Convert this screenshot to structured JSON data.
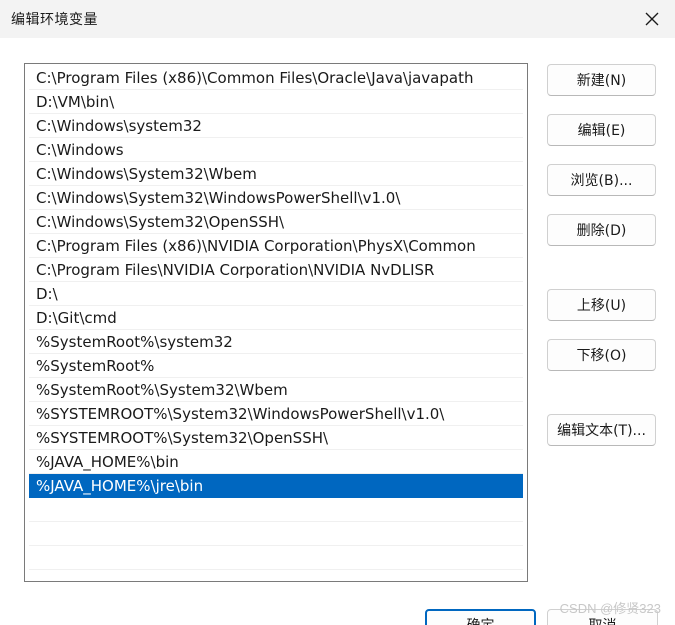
{
  "window": {
    "title": "编辑环境变量"
  },
  "path_list": {
    "entries": [
      "C:\\Program Files (x86)\\Common Files\\Oracle\\Java\\javapath",
      "D:\\VM\\bin\\",
      "C:\\Windows\\system32",
      "C:\\Windows",
      "C:\\Windows\\System32\\Wbem",
      "C:\\Windows\\System32\\WindowsPowerShell\\v1.0\\",
      "C:\\Windows\\System32\\OpenSSH\\",
      "C:\\Program Files (x86)\\NVIDIA Corporation\\PhysX\\Common",
      "C:\\Program Files\\NVIDIA Corporation\\NVIDIA NvDLISR",
      "D:\\",
      "D:\\Git\\cmd",
      "%SystemRoot%\\system32",
      "%SystemRoot%",
      "%SystemRoot%\\System32\\Wbem",
      "%SYSTEMROOT%\\System32\\WindowsPowerShell\\v1.0\\",
      "%SYSTEMROOT%\\System32\\OpenSSH\\",
      "%JAVA_HOME%\\bin",
      "%JAVA_HOME%\\jre\\bin"
    ],
    "selected_index": 17
  },
  "buttons": {
    "new": "新建(N)",
    "edit": "编辑(E)",
    "browse": "浏览(B)...",
    "delete": "删除(D)",
    "move_up": "上移(U)",
    "move_down": "下移(O)",
    "edit_text": "编辑文本(T)..."
  },
  "footer": {
    "ok": "确定",
    "cancel": "取消"
  },
  "watermark": "CSDN @修贤323",
  "colors": {
    "selection": "#0067c0",
    "titlebar": "#f3f3f3"
  },
  "icons": {
    "close": "close-icon"
  }
}
